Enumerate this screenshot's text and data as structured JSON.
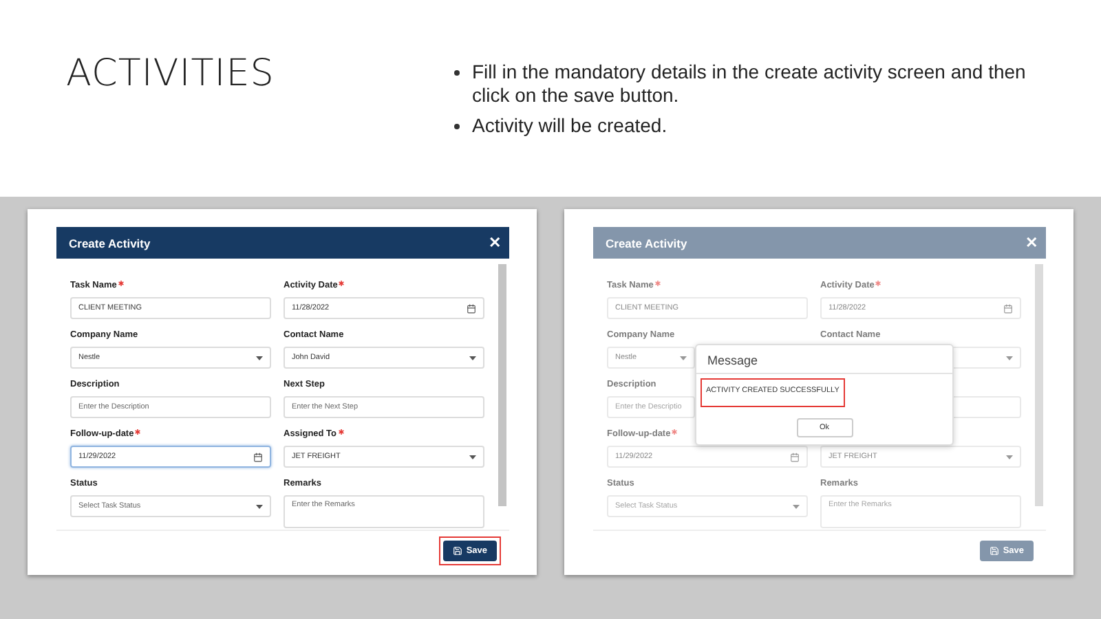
{
  "slide": {
    "title": "ACTIVITIES",
    "bullets": [
      "Fill in the mandatory details in the create activity screen and then click on the save button.",
      "Activity will be created."
    ]
  },
  "screens": [
    {
      "dimmed": false,
      "modal": {
        "title": "Create Activity",
        "close": "✕",
        "fields": [
          {
            "label": "Task Name",
            "required": true,
            "kind": "text",
            "value": "CLIENT MEETING",
            "focused": false
          },
          {
            "label": "Activity Date",
            "required": true,
            "kind": "date",
            "value": "11/28/2022",
            "focused": false
          },
          {
            "label": "Company Name",
            "required": false,
            "kind": "select",
            "value": "Nestle",
            "focused": false
          },
          {
            "label": "Contact Name",
            "required": false,
            "kind": "select",
            "value": "John David",
            "focused": false
          },
          {
            "label": "Description",
            "required": false,
            "kind": "text",
            "placeholder": "Enter the Description",
            "focused": false
          },
          {
            "label": "Next Step",
            "required": false,
            "kind": "text",
            "placeholder": "Enter the Next Step",
            "focused": false
          },
          {
            "label": "Follow-up-date",
            "required": true,
            "kind": "date",
            "value": "11/29/2022",
            "focused": true
          },
          {
            "label": "Assigned To",
            "required": true,
            "kind": "select",
            "value": "JET FREIGHT",
            "focused": false
          },
          {
            "label": "Status",
            "required": false,
            "kind": "select",
            "placeholder": "Select Task Status",
            "focused": false
          },
          {
            "label": "Remarks",
            "required": false,
            "kind": "textarea",
            "placeholder": "Enter the Remarks",
            "focused": false
          }
        ],
        "save": {
          "label": "Save",
          "highlighted": true
        }
      }
    },
    {
      "dimmed": true,
      "modal": {
        "title": "Create Activity",
        "close": "✕",
        "fields": [
          {
            "label": "Task Name",
            "required": true,
            "kind": "text",
            "value": "CLIENT MEETING",
            "focused": false
          },
          {
            "label": "Activity Date",
            "required": true,
            "kind": "date",
            "value": "11/28/2022",
            "focused": false
          },
          {
            "label": "Company Name",
            "required": false,
            "kind": "select",
            "value": "Nestle",
            "focused": false
          },
          {
            "label": "Contact Name",
            "required": false,
            "kind": "select",
            "focused": false
          },
          {
            "label": "Description",
            "required": false,
            "kind": "text",
            "placeholder": "Enter the Descriptio",
            "focused": false
          },
          {
            "kind": "text",
            "focused": false
          },
          {
            "label": "Follow-up-date",
            "required": true,
            "kind": "date",
            "value": "11/29/2022",
            "focused": false
          },
          {
            "kind": "select",
            "value": "JET FREIGHT",
            "focused": false
          },
          {
            "label": "Status",
            "required": false,
            "kind": "select",
            "placeholder": "Select Task Status",
            "focused": false
          },
          {
            "label": "Remarks",
            "required": false,
            "kind": "textarea",
            "placeholder": "Enter the Remarks",
            "focused": false
          }
        ],
        "save": {
          "label": "Save",
          "highlighted": false
        }
      },
      "message": {
        "title": "Message",
        "text": "ACTIVITY CREATED SUCCESSFULLY",
        "text_highlighted": true,
        "ok": "Ok"
      }
    }
  ]
}
